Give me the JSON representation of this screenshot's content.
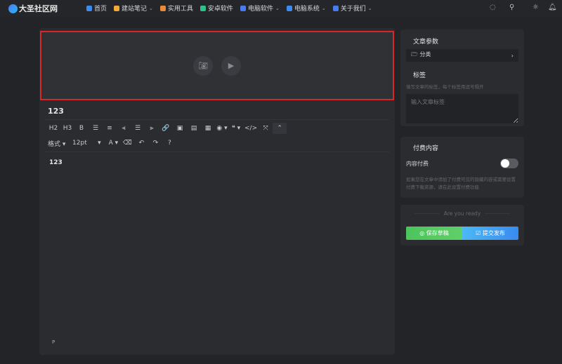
{
  "site": {
    "name": "大圣社区网"
  },
  "nav": [
    {
      "label": "首页",
      "icon": "home-icon",
      "color": "#3d8bf2",
      "dropdown": false
    },
    {
      "label": "建站笔记",
      "icon": "notebook-icon",
      "color": "#f2a93b",
      "dropdown": true
    },
    {
      "label": "实用工具",
      "icon": "toolbox-icon",
      "color": "#e88a3a",
      "dropdown": false
    },
    {
      "label": "安卓软件",
      "icon": "android-icon",
      "color": "#2ec28b",
      "dropdown": false
    },
    {
      "label": "电脑软件",
      "icon": "software-icon",
      "color": "#4a7cf0",
      "dropdown": true
    },
    {
      "label": "电脑系统",
      "icon": "monitor-icon",
      "color": "#3d8bf2",
      "dropdown": true
    },
    {
      "label": "关于我们",
      "icon": "users-icon",
      "color": "#4a7cf0",
      "dropdown": true
    }
  ],
  "editor": {
    "title": "123",
    "toolbar_row1": [
      "H2",
      "H3",
      "B",
      "☰",
      "≡",
      "⫷",
      "☰",
      "⫸",
      "🔗",
      "▣",
      "▤",
      "▦",
      "◉ ▾",
      "❝ ▾",
      "</>",
      "⤧",
      "⌃"
    ],
    "toolbar_row2": [
      {
        "label": "格式 ▾"
      },
      {
        "label": "12pt"
      },
      {
        "label": "▾"
      },
      {
        "label": "A ▾"
      },
      {
        "label": "⌫"
      },
      {
        "label": "↶"
      },
      {
        "label": "↷"
      },
      {
        "label": "?"
      }
    ],
    "content": "123",
    "path": "P"
  },
  "sidebar": {
    "params_title": "文章参数",
    "category_label": "分类",
    "tags_title": "标签",
    "tags_hint": "填写文章的标签，每个标签用逗号隔开",
    "tags_placeholder": "输入文章标签",
    "paid_title": "付费内容",
    "paid_label": "内容付费",
    "paid_enabled": false,
    "paid_hint": "如果您在文章中添加了付费可见的隐藏内容或需要设置付费下载资源，请在此设置付费功能",
    "ready": "Are you ready",
    "save_label": "保存草稿",
    "publish_label": "提交发布"
  },
  "colors": {
    "accent_red": "#d8262b",
    "save_green": "#4cc45c",
    "publish_blue": "#3a9af0"
  }
}
